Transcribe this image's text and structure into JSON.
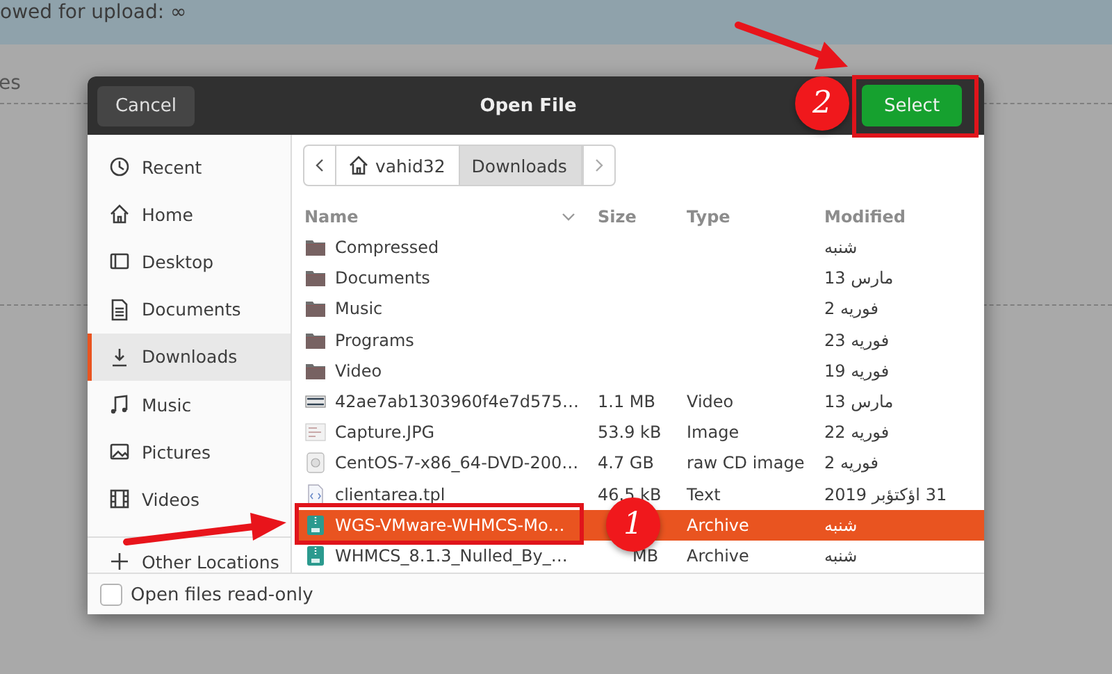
{
  "background": {
    "upload_note": "owed for upload: ∞",
    "side_text": "es"
  },
  "dialog": {
    "title": "Open File",
    "cancel": "Cancel",
    "select": "Select",
    "sidebar": [
      {
        "label": "Recent",
        "kind": "recent",
        "selected": false
      },
      {
        "label": "Home",
        "kind": "home",
        "selected": false
      },
      {
        "label": "Desktop",
        "kind": "desktop",
        "selected": false
      },
      {
        "label": "Documents",
        "kind": "document",
        "selected": false
      },
      {
        "label": "Downloads",
        "kind": "download",
        "selected": true
      },
      {
        "label": "Music",
        "kind": "music",
        "selected": false
      },
      {
        "label": "Pictures",
        "kind": "picture",
        "selected": false
      },
      {
        "label": "Videos",
        "kind": "video",
        "selected": false
      },
      {
        "label": "Other Locations",
        "kind": "add",
        "selected": false
      }
    ],
    "path": [
      {
        "label": "vahid32",
        "kind": "home",
        "selected": false
      },
      {
        "label": "Downloads",
        "kind": "folder",
        "selected": true
      }
    ],
    "columns": [
      "Name",
      "Size",
      "Type",
      "Modified"
    ],
    "files": [
      {
        "name": "Compressed",
        "kind": "folder",
        "modified": "شنبه",
        "selected": false
      },
      {
        "name": "Documents",
        "kind": "folder",
        "modified": "مارس 13",
        "selected": false
      },
      {
        "name": "Music",
        "kind": "folder",
        "modified": "فوریه 2",
        "selected": false
      },
      {
        "name": "Programs",
        "kind": "folder",
        "modified": "فوریه 23",
        "selected": false
      },
      {
        "name": "Video",
        "kind": "folder",
        "modified": "فوریه 19",
        "selected": false
      },
      {
        "name": "42ae7ab1303960f4e7d575…",
        "kind": "video",
        "size": "1.1 MB",
        "type": "Video",
        "modified": "مارس 13",
        "selected": false
      },
      {
        "name": "Capture.JPG",
        "kind": "image",
        "size": "53.9 kB",
        "type": "Image",
        "modified": "فوریه 22",
        "selected": false
      },
      {
        "name": "CentOS-7-x86_64-DVD-200…",
        "kind": "disc",
        "size": "4.7 GB",
        "type": "raw CD image",
        "modified": "فوریه 2",
        "selected": false
      },
      {
        "name": "clientarea.tpl",
        "kind": "text",
        "size": "46.5 kB",
        "type": "Text",
        "modified": "31 اؤکتؤبر 2019",
        "selected": false
      },
      {
        "name": "WGS-VMware-WHMCS-Mo…",
        "kind": "archive",
        "type": "Archive",
        "modified": "شنبه",
        "selected": true
      },
      {
        "name": "WHMCS_8.1.3_Nulled_By_…",
        "kind": "archive",
        "size": "MB",
        "type": "Archive",
        "modified": "شنبه",
        "selected": false
      }
    ],
    "read_only": {
      "label": "Open files read-only",
      "checked": false
    }
  },
  "annotations": [
    {
      "number": "1"
    },
    {
      "number": "2"
    }
  ]
}
